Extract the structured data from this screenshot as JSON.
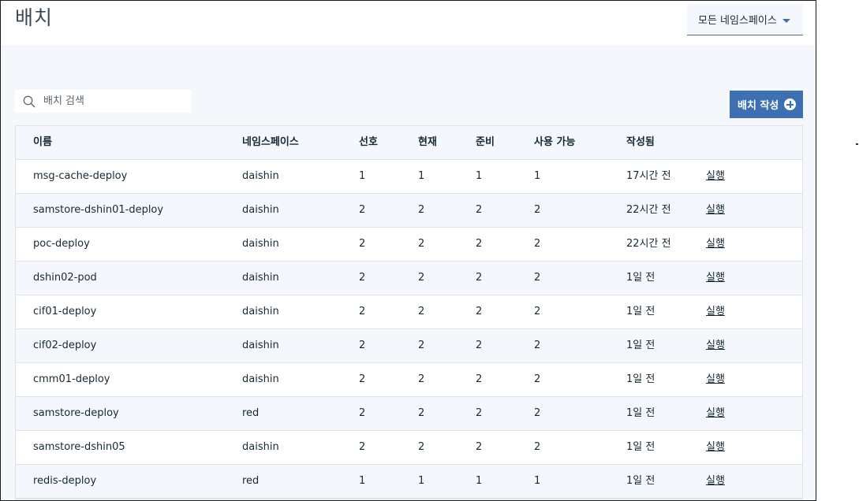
{
  "header": {
    "title": "배치",
    "namespace_dropdown": "모든 네임스페이스"
  },
  "toolbar": {
    "search_placeholder": "배치 검색",
    "create_button": "배치 작성"
  },
  "table": {
    "columns": {
      "name": "이름",
      "namespace": "네임스페이스",
      "desired": "선호",
      "current": "현재",
      "ready": "준비",
      "available": "사용 가능",
      "created": "작성됨"
    },
    "rows": [
      {
        "name": "msg-cache-deploy",
        "namespace": "daishin",
        "desired": "1",
        "current": "1",
        "ready": "1",
        "available": "1",
        "created": "17시간 전",
        "action": "실행"
      },
      {
        "name": "samstore-dshin01-deploy",
        "namespace": "daishin",
        "desired": "2",
        "current": "2",
        "ready": "2",
        "available": "2",
        "created": "22시간 전",
        "action": "실행"
      },
      {
        "name": "poc-deploy",
        "namespace": "daishin",
        "desired": "2",
        "current": "2",
        "ready": "2",
        "available": "2",
        "created": "22시간 전",
        "action": "실행"
      },
      {
        "name": "dshin02-pod",
        "namespace": "daishin",
        "desired": "2",
        "current": "2",
        "ready": "2",
        "available": "2",
        "created": "1일 전",
        "action": "실행"
      },
      {
        "name": "cif01-deploy",
        "namespace": "daishin",
        "desired": "2",
        "current": "2",
        "ready": "2",
        "available": "2",
        "created": "1일 전",
        "action": "실행"
      },
      {
        "name": "cif02-deploy",
        "namespace": "daishin",
        "desired": "2",
        "current": "2",
        "ready": "2",
        "available": "2",
        "created": "1일 전",
        "action": "실행"
      },
      {
        "name": "cmm01-deploy",
        "namespace": "daishin",
        "desired": "2",
        "current": "2",
        "ready": "2",
        "available": "2",
        "created": "1일 전",
        "action": "실행"
      },
      {
        "name": "samstore-deploy",
        "namespace": "red",
        "desired": "2",
        "current": "2",
        "ready": "2",
        "available": "2",
        "created": "1일 전",
        "action": "실행"
      },
      {
        "name": "samstore-dshin05",
        "namespace": "daishin",
        "desired": "2",
        "current": "2",
        "ready": "2",
        "available": "2",
        "created": "1일 전",
        "action": "실행"
      },
      {
        "name": "redis-deploy",
        "namespace": "red",
        "desired": "1",
        "current": "1",
        "ready": "1",
        "available": "1",
        "created": "1일 전",
        "action": "실행"
      }
    ]
  }
}
